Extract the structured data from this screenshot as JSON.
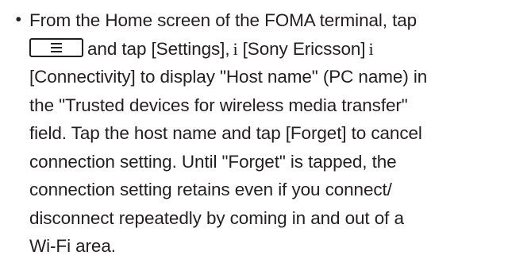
{
  "bullet_symbol": "・",
  "lines": {
    "l1": "From the Home screen of the FOMA terminal, tap",
    "l2_after_key": "and tap [Settings],",
    "l2_arrow": "i",
    "l2_tail": "[Sony Ericsson]",
    "l2_arrow2": "i",
    "l3": "[Connectivity] to display \"Host name\" (PC name) in",
    "l4": "the \"Trusted devices for wireless media transfer\"",
    "l5": "field. Tap the host name and tap [Forget] to cancel",
    "l6": "connection setting. Until \"Forget\" is tapped, the",
    "l7": "connection setting retains even if you connect/",
    "l8": "disconnect repeatedly by coming in and out of a",
    "l9": "Wi-Fi area."
  },
  "menu_key_icon": "menu-lines-icon"
}
